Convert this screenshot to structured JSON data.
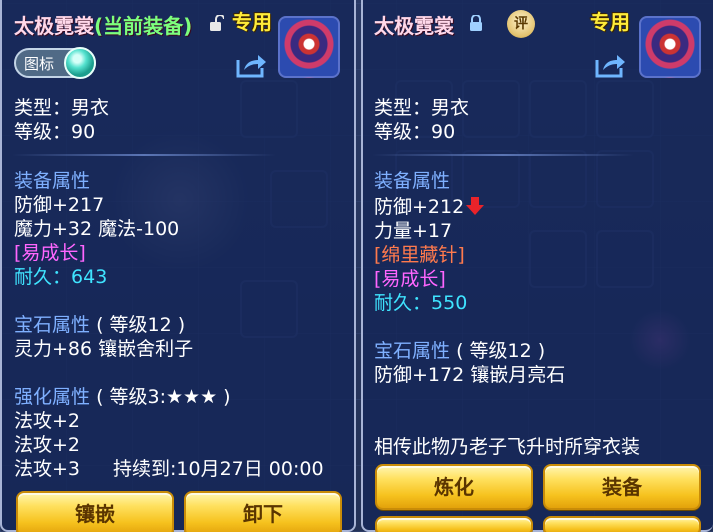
{
  "left_panel": {
    "title_name": "太极霓裳",
    "title_status": "(当前装备)",
    "exclusive_tag": "专用",
    "toggle_label": "图标",
    "type_line": "类型：男衣",
    "level_line": "等级：90",
    "equip_attr_header": "装备属性",
    "attr_lines": [
      "防御+217",
      "魔力+32 魔法-100"
    ],
    "trait": "[易成长]",
    "durability_label": "耐久：",
    "durability_value": "643",
    "gem_header": "宝石属性",
    "gem_level": "( 等级12 )",
    "gem_line": "灵力+86 镶嵌舍利子",
    "enhance_header": "强化属性",
    "enhance_level": "( 等级3:★★★ )",
    "enhance_lines": [
      "法攻+2",
      "法攻+2"
    ],
    "enhance_last": "法攻+3",
    "duration_text": "持续到:10月27日 00:00",
    "buttons": [
      "镶嵌",
      "卸下"
    ]
  },
  "right_panel": {
    "title_name": "太极霓裳",
    "rating_badge": "评",
    "exclusive_tag": "专用",
    "type_line": "类型：男衣",
    "level_line": "等级：90",
    "equip_attr_header": "装备属性",
    "defense_line": "防御+212",
    "strength_line": "力量+17",
    "special_skill": "[绵里藏针]",
    "trait": "[易成长]",
    "durability_label": "耐久：",
    "durability_value": "550",
    "gem_header": "宝石属性",
    "gem_level": "( 等级12 )",
    "gem_line": "防御+172 镶嵌月亮石",
    "description": "相传此物乃老子飞升时所穿衣装",
    "buttons": [
      "炼化",
      "装备"
    ]
  },
  "colors": {
    "title": "#ffd8ea",
    "current_equip": "#7dff7d",
    "exclusive": "#ffec3a",
    "section_header": "#7fb0ff",
    "trait": "#ff66ff",
    "durability": "#3fe4ff",
    "special_skill": "#ff7a4d",
    "button_gold": "#f6c21e"
  }
}
